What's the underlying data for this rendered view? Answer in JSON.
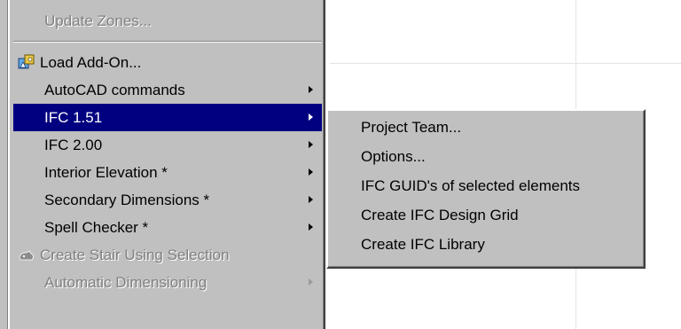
{
  "menu": {
    "items": [
      {
        "label": "Update Zones...",
        "state": "disabled",
        "submenu": false
      },
      {
        "label": "Load Add-On...",
        "state": "enabled",
        "icon": "add-on-icon",
        "submenu": false
      },
      {
        "label": "AutoCAD commands",
        "state": "enabled",
        "submenu": true
      },
      {
        "label": "IFC 1.51",
        "state": "selected",
        "submenu": true
      },
      {
        "label": "IFC 2.00",
        "state": "enabled",
        "submenu": true
      },
      {
        "label": "Interior Elevation *",
        "state": "enabled",
        "submenu": true
      },
      {
        "label": "Secondary Dimensions *",
        "state": "enabled",
        "submenu": true
      },
      {
        "label": "Spell Checker *",
        "state": "enabled",
        "submenu": true
      },
      {
        "label": "Create Stair Using Selection",
        "state": "disabled",
        "icon": "stair-icon",
        "submenu": false
      },
      {
        "label": "Automatic Dimensioning",
        "state": "disabled",
        "submenu": true
      }
    ]
  },
  "submenu": {
    "parent": "IFC 1.51",
    "items": [
      {
        "label": "Project Team..."
      },
      {
        "label": "Options..."
      },
      {
        "label": "IFC GUID's of selected elements"
      },
      {
        "label": "Create IFC Design Grid"
      },
      {
        "label": "Create IFC Library"
      }
    ]
  },
  "colors": {
    "menu_bg": "#c0c0c0",
    "highlight": "#000080",
    "disabled_text": "#808080"
  }
}
